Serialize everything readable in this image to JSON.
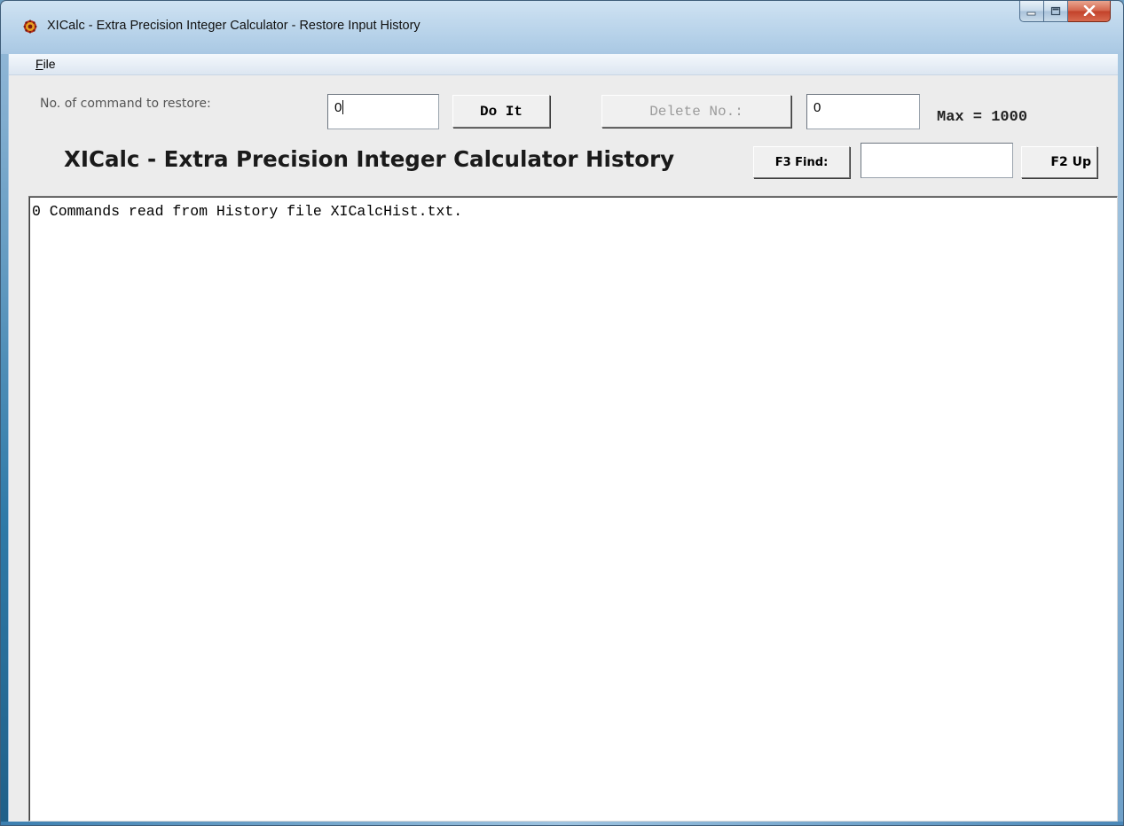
{
  "window": {
    "title": "XICalc - Extra Precision Integer Calculator - Restore Input History",
    "app_icon": "gear-icon",
    "controls": {
      "minimize_icon": "minimize-icon",
      "maximize_icon": "maximize-icon",
      "close_icon": "close-icon"
    }
  },
  "menu": {
    "file_label": "File"
  },
  "toolbar": {
    "command_label": "No. of command to restore:",
    "command_value": "0",
    "do_it_label": "Do It",
    "delete_label": "Delete No.:",
    "delete_value": "0",
    "max_label": "Max = 1000"
  },
  "header": {
    "title": "XICalc - Extra Precision Integer Calculator History",
    "find_label": "F3 Find:",
    "find_value": "",
    "up_label": "F2 Up"
  },
  "history": {
    "lines": [
      "0 Commands read from History file XICalcHist.txt."
    ]
  },
  "colors": {
    "client_background": "#ececec",
    "disabled_text": "#9b9b9b"
  }
}
